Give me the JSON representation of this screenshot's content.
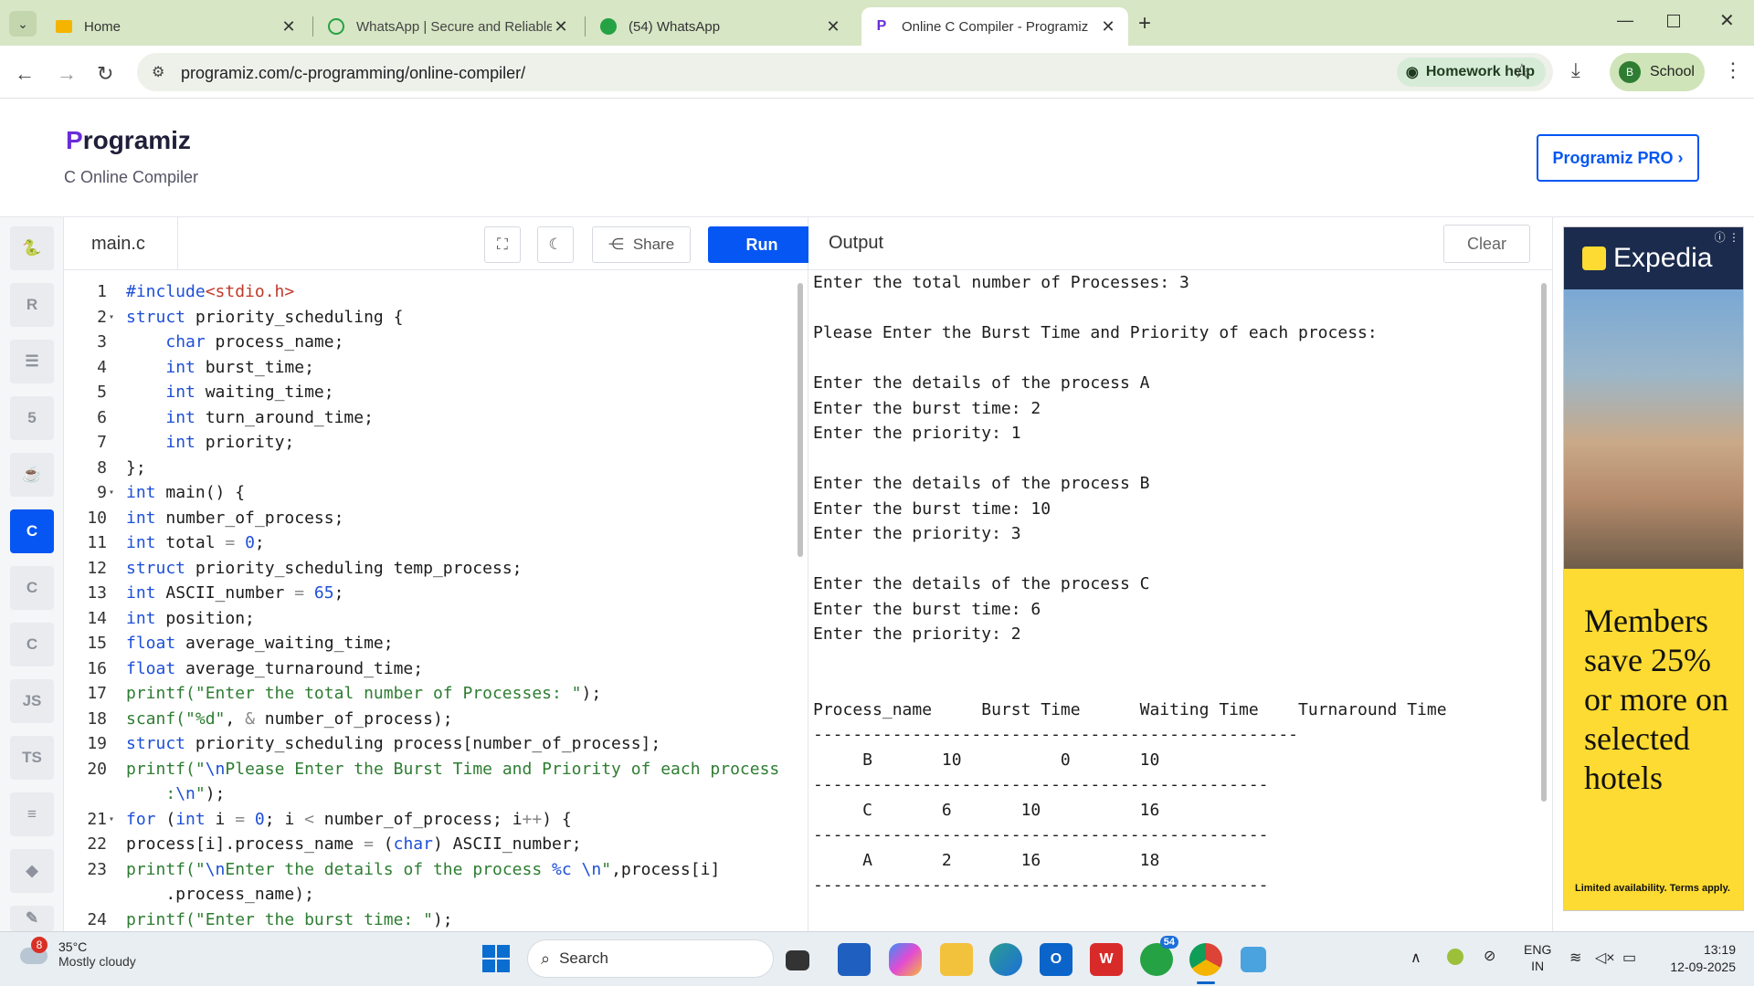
{
  "browser": {
    "tabs": [
      {
        "title": "Home",
        "icon": "home-icon"
      },
      {
        "title": "WhatsApp | Secure and Reliable",
        "icon": "whatsapp-icon"
      },
      {
        "title": "(54) WhatsApp",
        "icon": "whatsapp-icon"
      },
      {
        "title": "Online C Compiler - Programiz",
        "icon": "programiz-icon",
        "active": true
      }
    ],
    "url": "programiz.com/c-programming/online-compiler/",
    "homework_help": "Homework help",
    "profile_initial": "B",
    "profile_label": "School"
  },
  "site": {
    "logo": "Programiz",
    "logo_first": "P",
    "logo_rest": "rogramiz",
    "subtitle": "C Online Compiler",
    "pro_button": "Programiz PRO ›"
  },
  "sidebar": {
    "languages": [
      "python",
      "r",
      "sql",
      "html",
      "java",
      "c",
      "cpp",
      "csharp",
      "JS",
      "TS",
      "go",
      "swift"
    ],
    "active": "c"
  },
  "editor": {
    "filename": "main.c",
    "share_label": "Share",
    "run_label": "Run"
  },
  "output": {
    "title": "Output",
    "clear_label": "Clear",
    "lines": [
      "Enter the total number of Processes: 3",
      "",
      "Please Enter the Burst Time and Priority of each process:",
      "",
      "Enter the details of the process A",
      "Enter the burst time: 2",
      "Enter the priority: 1",
      "",
      "Enter the details of the process B",
      "Enter the burst time: 10",
      "Enter the priority: 3",
      "",
      "Enter the details of the process C",
      "Enter the burst time: 6",
      "Enter the priority: 2",
      "",
      "",
      "Process_name     Burst Time      Waiting Time    Turnaround Time",
      "-------------------------------------------------",
      "     B       10          0       10",
      "----------------------------------------------",
      "     C       6       10          16",
      "----------------------------------------------",
      "     A       2       16          18",
      "----------------------------------------------"
    ]
  },
  "ad": {
    "brand": "Expedia",
    "headline": "Members save 25% or more on selected hotels",
    "fineprint": "Limited availability. Terms apply."
  },
  "taskbar": {
    "weather_badge": "8",
    "temperature": "35°C",
    "condition": "Mostly cloudy",
    "search_placeholder": "Search",
    "whatsapp_badge": "54",
    "lang_top": "ENG",
    "lang_bottom": "IN",
    "time": "13:19",
    "date": "12-09-2025"
  },
  "colors": {
    "accent": "#0556f3",
    "tabbar": "#d7e6c5",
    "keyword": "#1d4fd8",
    "string": "#2e7d32",
    "ad_yellow": "#fddb32"
  }
}
